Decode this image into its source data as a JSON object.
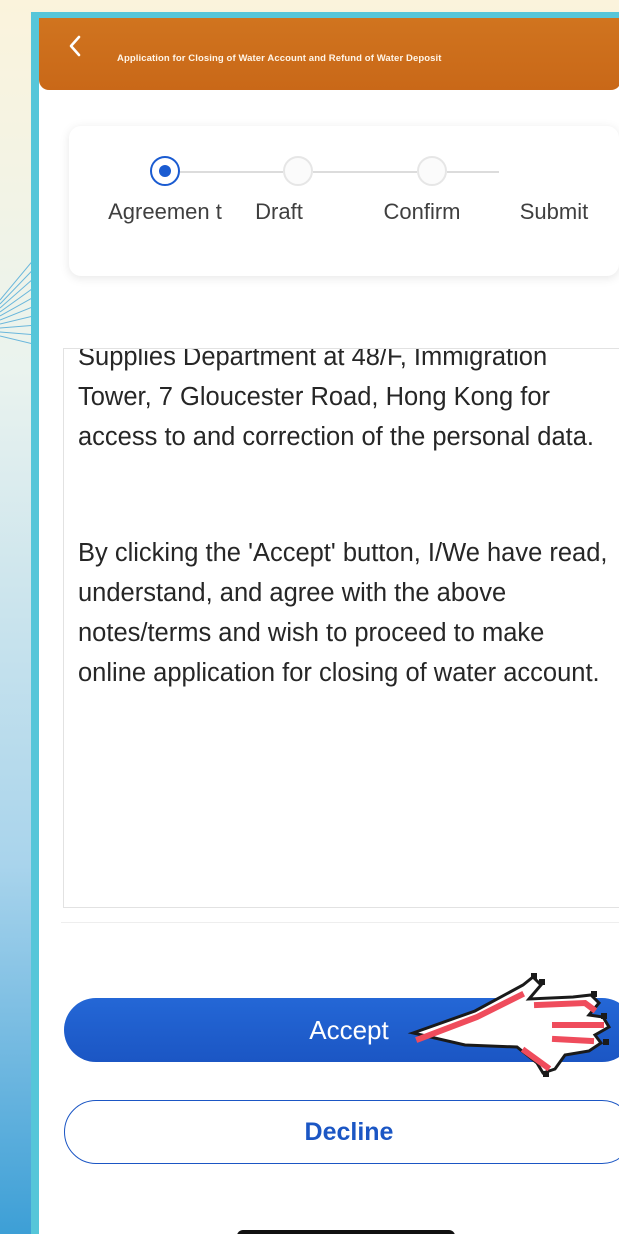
{
  "app": {
    "title": "Application for Closing of Water Account and Refund of Water Deposit",
    "back_icon": "chevron-left-icon"
  },
  "stepper": {
    "steps": [
      {
        "label": "Agreemen t",
        "state": "active"
      },
      {
        "label": "Draft",
        "state": "inactive"
      },
      {
        "label": "Confirm",
        "state": "inactive"
      },
      {
        "label": "Submit",
        "state": "inactive"
      }
    ],
    "active_color": "#1a5bd1"
  },
  "terms": {
    "paragraphs": [
      "Supplies Department at 48/F, Immigration Tower, 7 Gloucester Road, Hong Kong for access to and correction of the personal data.",
      "By clicking the 'Accept' button, I/We have read, understand, and agree with the above notes/terms and wish to proceed to make online application for closing of water account."
    ]
  },
  "actions": {
    "accept_label": "Accept",
    "decline_label": "Decline"
  },
  "colors": {
    "header": "#c96818",
    "primary": "#1b56c4",
    "frame": "#56c6d9"
  },
  "overlay": {
    "pointer_icon": "hand-pointer-icon"
  }
}
